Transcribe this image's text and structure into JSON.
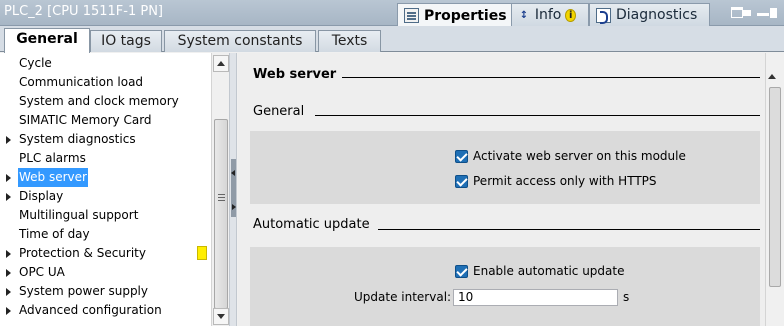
{
  "window": {
    "title": "PLC_2 [CPU 1511F-1 PN]",
    "tabs": [
      {
        "label": "Properties",
        "icon": "properties-icon",
        "active": true
      },
      {
        "label": "Info",
        "icon": "info-icon",
        "active": false,
        "badge": "i"
      },
      {
        "label": "Diagnostics",
        "icon": "diagnostics-icon",
        "active": false
      }
    ]
  },
  "tabs": [
    "General",
    "IO tags",
    "System constants",
    "Texts"
  ],
  "tree": [
    {
      "label": "Cycle",
      "expandable": false
    },
    {
      "label": "Communication load",
      "expandable": false
    },
    {
      "label": "System and clock memory",
      "expandable": false
    },
    {
      "label": "SIMATIC Memory Card",
      "expandable": false
    },
    {
      "label": "System diagnostics",
      "expandable": true
    },
    {
      "label": "PLC alarms",
      "expandable": false
    },
    {
      "label": "Web server",
      "expandable": true,
      "selected": true
    },
    {
      "label": "Display",
      "expandable": true
    },
    {
      "label": "Multilingual support",
      "expandable": false
    },
    {
      "label": "Time of day",
      "expandable": false
    },
    {
      "label": "Protection & Security",
      "expandable": true
    },
    {
      "label": "OPC UA",
      "expandable": true
    },
    {
      "label": "System power supply",
      "expandable": true
    },
    {
      "label": "Advanced configuration",
      "expandable": true
    }
  ],
  "content": {
    "title": "Web server",
    "general": {
      "heading": "General",
      "checkboxes": [
        {
          "label": "Activate web server on this module",
          "checked": true
        },
        {
          "label": "Permit access only with HTTPS",
          "checked": true
        }
      ]
    },
    "auto_update": {
      "heading": "Automatic update",
      "checkbox": {
        "label": "Enable automatic update",
        "checked": true
      },
      "interval_label": "Update interval:",
      "interval_value": "10",
      "interval_unit": "s"
    }
  },
  "colors": {
    "selection": "#3399ff",
    "checkbox": "#1f6fb5",
    "marker": "#ffee00",
    "titlebar": "#a7b6c5"
  }
}
